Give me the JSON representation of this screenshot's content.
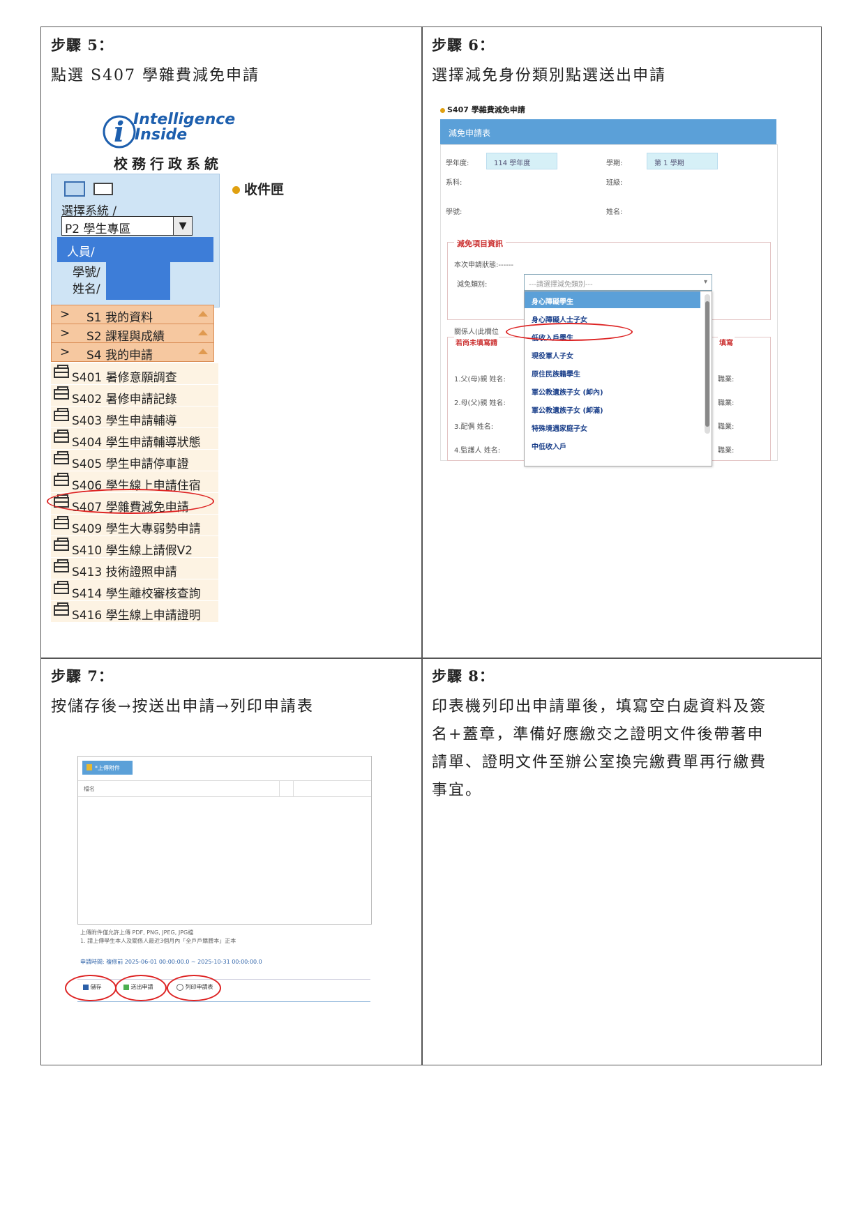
{
  "steps": {
    "s5": {
      "title": "步驟 5：",
      "desc": "點選 S407 學雜費減免申請"
    },
    "s6": {
      "title": "步驟 6：",
      "desc": "選擇減免身份類別點選送出申請"
    },
    "s7": {
      "title": "步驟 7：",
      "desc": "按儲存後→按送出申請→列印申請表"
    },
    "s8": {
      "title": "步驟 8：",
      "desc": "印表機列印出申請單後，填寫空白處資料及簽名+蓋章，準備好應繳交之證明文件後帶著申請單、證明文件至辦公室換完繳費單再行繳費事宜。"
    }
  },
  "step5": {
    "logo_line1": "Intelligence",
    "logo_line2": "Inside",
    "system_name": "校務行政系統",
    "inbox": "收件匣",
    "select_system_label": "選擇系統 /",
    "select_value": "P2 學生專區",
    "person_label": "人員/",
    "student_id_label": "學號/",
    "name_label": "姓名/",
    "menus": [
      {
        "arrow": ">",
        "label": "S1 我的資料"
      },
      {
        "arrow": ">",
        "label": "S2 課程與成績"
      },
      {
        "arrow": ">",
        "label": "S4 我的申請"
      }
    ],
    "items": [
      "S401 暑修意願調查",
      "S402 暑修申請記錄",
      "S403 學生申請輔導",
      "S404 學生申請輔導狀態",
      "S405 學生申請停車證",
      "S406 學生線上申請住宿",
      "S407 學雜費減免申請",
      "S409 學生大專弱勢申請",
      "S410 學生線上請假V2",
      "S413 技術證照申請",
      "S414 學生離校審核查詢",
      "S416 學生線上申請證明"
    ]
  },
  "step6": {
    "page_title": "S407 學雜費減免申請",
    "form_title": "減免申請表",
    "year_label": "學年度:",
    "year_value": "114 學年度",
    "term_label": "學期:",
    "term_value": "第 1 學期",
    "dept_label": "系科:",
    "class_label": "班級:",
    "sid_label": "學號:",
    "name_label": "姓名:",
    "section_title": "減免項目資訊",
    "status_label": "本次申請狀態:------",
    "type_label": "減免類別:",
    "type_placeholder": "---請選擇減免類別---",
    "relation_label": "關係人(此欄位",
    "warn_text": "若尚未填寫請",
    "warn_tail": "填寫",
    "rel_rows": [
      "1.父(母)親 姓名:",
      "2.母(父)親 姓名:",
      "3.配偶 姓名:",
      "4.監護人 姓名:"
    ],
    "job_label": "職業:",
    "options": [
      "身心障礙學生",
      "身心障礙人士子女",
      "低收入戶學生",
      "現役軍人子女",
      "原住民族籍學生",
      "軍公教遺族子女 (卹內)",
      "軍公教遺族子女 (卹滿)",
      "特殊境遇家庭子女",
      "中低收入戶"
    ]
  },
  "step7": {
    "upload_button": "*上傳附件",
    "file_header": "檔名",
    "note1": "上傳附件僅允許上傳 PDF, PNG, JPEG, JPG檔",
    "note2": "1. 請上傳學生本人及關係人最近3個月內「全戶戶籍謄本」正本",
    "period": "申請時間: 複修前 2025-06-01 00:00:00.0 ~ 2025-10-31 00:00:00.0",
    "save": "儲存",
    "submit": "送出申請",
    "print": "列印申請表"
  }
}
